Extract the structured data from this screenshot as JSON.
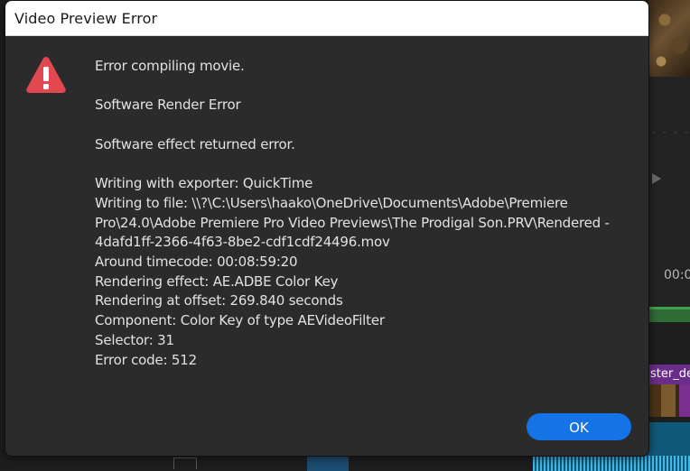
{
  "dialog": {
    "title": "Video Preview Error",
    "icon": "warning-triangle-icon",
    "icon_color": "#e34850",
    "messages": {
      "line1": "Error compiling movie.",
      "line2": "Software Render Error",
      "line3": "Software effect returned error.",
      "exporter": "Writing with exporter: QuickTime",
      "file_l1": "Writing  to  file:  \\\\?\\C:\\Users\\haako\\OneDrive\\Documents\\Adobe\\Premiere",
      "file_l2": "Pro\\24.0\\Adobe Premiere Pro Video Previews\\The Prodigal Son.PRV\\Rendered -",
      "file_l3": "4dafd1ff-2366-4f63-8be2-cdf1cdf24496.mov",
      "timecode": "Around timecode: 00:08:59:20",
      "effect": "Rendering effect: AE.ADBE Color Key",
      "offset": "Rendering at offset: 269.840 seconds",
      "component": "Component: Color Key of type AEVideoFilter",
      "selector": "Selector: 31",
      "error_code": "Error code: 512"
    },
    "ok_label": "OK",
    "accent_color": "#1473e6"
  },
  "background": {
    "timecode_partial": "00:0",
    "clip_label": "ster_de"
  }
}
